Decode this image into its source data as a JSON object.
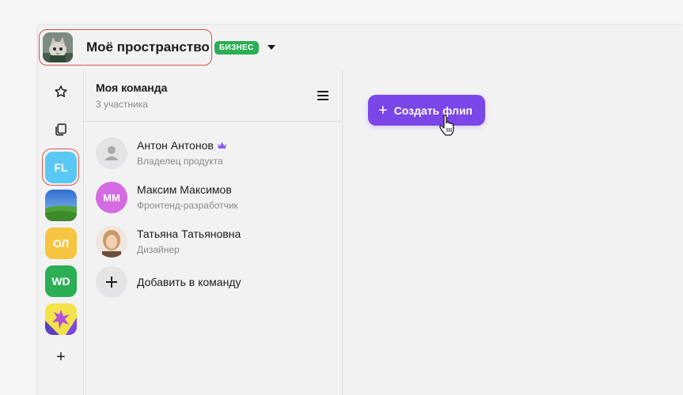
{
  "header": {
    "workspace_title": "Моё пространство",
    "plan_badge": "БИЗНЕС"
  },
  "rail": {
    "items": [
      {
        "icon": "star-icon"
      },
      {
        "icon": "copy-icon"
      },
      {
        "label": "FL",
        "color": "#5ac8f5",
        "selected": true
      },
      {
        "label": "",
        "image": "landscape"
      },
      {
        "label": "ОЛ",
        "color": "#f5c542"
      },
      {
        "label": "WD",
        "color": "#2cae55"
      },
      {
        "label": "",
        "image": "pattern"
      },
      {
        "label": "+"
      }
    ]
  },
  "team": {
    "title": "Моя команда",
    "subtitle": "3 участника",
    "members": [
      {
        "name": "Антон Антонов",
        "role": "Владелец продукта",
        "owner": true
      },
      {
        "name": "Максим Максимов",
        "role": "Фронтенд-разработчик",
        "initials": "ММ",
        "color": "#d46be3"
      },
      {
        "name": "Татьяна Татьяновна",
        "role": "Дизайнер"
      }
    ],
    "add_label": "Добавить в команду"
  },
  "main": {
    "create_button": "Создать флип"
  },
  "colors": {
    "accent": "#7b46e8",
    "badge": "#2cae55",
    "highlight": "#d9534f"
  }
}
